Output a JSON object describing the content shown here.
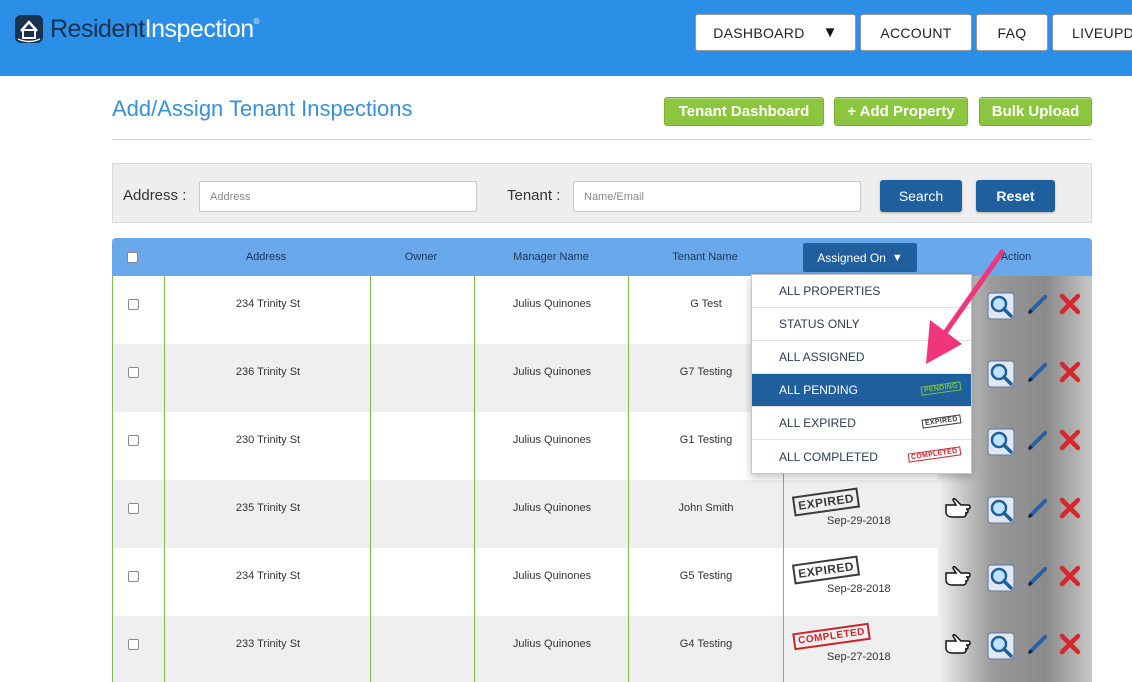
{
  "brand": {
    "name_part1": "Resident",
    "name_part2": "Inspection",
    "mark": "®"
  },
  "nav": {
    "dashboard": "DASHBOARD",
    "account": "ACCOUNT",
    "faq": "FAQ",
    "liveupdate": "LIVEUPD",
    "caret": "▼"
  },
  "page": {
    "title": "Add/Assign Tenant Inspections",
    "buttons": {
      "tenant_dashboard": "Tenant Dashboard",
      "add_property": "+ Add Property",
      "bulk_upload": "Bulk Upload"
    }
  },
  "filter": {
    "address_label": "Address :",
    "address_placeholder": "Address",
    "tenant_label": "Tenant :",
    "tenant_placeholder": "Name/Email",
    "search": "Search",
    "reset": "Reset"
  },
  "table": {
    "headers": {
      "address": "Address",
      "owner": "Owner",
      "manager": "Manager Name",
      "tenant": "Tenant Name",
      "assigned": "Assigned On",
      "action": "Action"
    },
    "rows": [
      {
        "address": "234 Trinity St",
        "owner": "",
        "manager": "Julius Quinones",
        "tenant": "G Test",
        "status": "",
        "date": ""
      },
      {
        "address": "236 Trinity St",
        "owner": "",
        "manager": "Julius Quinones",
        "tenant": "G7 Testing",
        "status": "",
        "date": ""
      },
      {
        "address": "230 Trinity St",
        "owner": "",
        "manager": "Julius Quinones",
        "tenant": "G1 Testing",
        "status": "",
        "date": ""
      },
      {
        "address": "235 Trinity St",
        "owner": "",
        "manager": "Julius Quinones",
        "tenant": "John Smith",
        "status": "EXPIRED",
        "date": "Sep-29-2018"
      },
      {
        "address": "234 Trinity St",
        "owner": "",
        "manager": "Julius Quinones",
        "tenant": "G5 Testing",
        "status": "EXPIRED",
        "date": "Sep-28-2018"
      },
      {
        "address": "233 Trinity St",
        "owner": "",
        "manager": "Julius Quinones",
        "tenant": "G4 Testing",
        "status": "COMPLETED",
        "date": "Sep-27-2018"
      }
    ]
  },
  "dropdown": {
    "items": [
      {
        "label": "ALL PROPERTIES",
        "stamp": ""
      },
      {
        "label": "STATUS ONLY",
        "stamp": ""
      },
      {
        "label": "ALL ASSIGNED",
        "stamp": ""
      },
      {
        "label": "ALL PENDING",
        "stamp": "PENDING"
      },
      {
        "label": "ALL EXPIRED",
        "stamp": "EXPIRED"
      },
      {
        "label": "ALL COMPLETED",
        "stamp": "COMPLETED"
      }
    ],
    "selected": "ALL PENDING"
  },
  "colors": {
    "header_bg": "#2b8fe8",
    "title": "#3b8fd6",
    "green_btn": "#8cc63f",
    "primary_btn": "#1f5f9d",
    "table_head": "#6aa8ec",
    "arrow": "#f0357d",
    "delete": "#d9262a"
  },
  "icons": [
    "house-logo-icon",
    "pointer-hand-icon",
    "magnifier-icon",
    "pencil-icon",
    "delete-x-icon",
    "caret-down-icon",
    "annotation-arrow-icon"
  ]
}
